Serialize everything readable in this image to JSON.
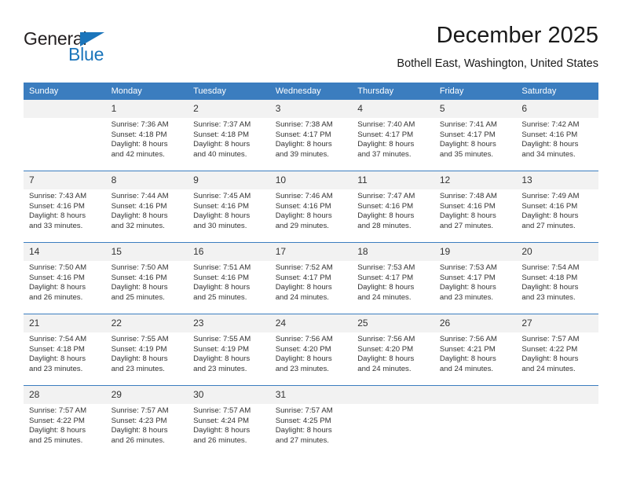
{
  "brand": {
    "name_part1": "General",
    "name_part2": "Blue",
    "triangle_icon": "triangle-icon"
  },
  "header": {
    "title": "December 2025",
    "subtitle": "Bothell East, Washington, United States"
  },
  "colors": {
    "header_blue": "#3b7dbf",
    "brand_blue": "#1b75bb",
    "daynum_bg": "#f2f2f2",
    "text": "#333333"
  },
  "weekday_headers": [
    "Sunday",
    "Monday",
    "Tuesday",
    "Wednesday",
    "Thursday",
    "Friday",
    "Saturday"
  ],
  "weeks": [
    [
      {
        "day": "",
        "sunrise": "",
        "sunset": "",
        "daylight1": "",
        "daylight2": ""
      },
      {
        "day": "1",
        "sunrise": "Sunrise: 7:36 AM",
        "sunset": "Sunset: 4:18 PM",
        "daylight1": "Daylight: 8 hours",
        "daylight2": "and 42 minutes."
      },
      {
        "day": "2",
        "sunrise": "Sunrise: 7:37 AM",
        "sunset": "Sunset: 4:18 PM",
        "daylight1": "Daylight: 8 hours",
        "daylight2": "and 40 minutes."
      },
      {
        "day": "3",
        "sunrise": "Sunrise: 7:38 AM",
        "sunset": "Sunset: 4:17 PM",
        "daylight1": "Daylight: 8 hours",
        "daylight2": "and 39 minutes."
      },
      {
        "day": "4",
        "sunrise": "Sunrise: 7:40 AM",
        "sunset": "Sunset: 4:17 PM",
        "daylight1": "Daylight: 8 hours",
        "daylight2": "and 37 minutes."
      },
      {
        "day": "5",
        "sunrise": "Sunrise: 7:41 AM",
        "sunset": "Sunset: 4:17 PM",
        "daylight1": "Daylight: 8 hours",
        "daylight2": "and 35 minutes."
      },
      {
        "day": "6",
        "sunrise": "Sunrise: 7:42 AM",
        "sunset": "Sunset: 4:16 PM",
        "daylight1": "Daylight: 8 hours",
        "daylight2": "and 34 minutes."
      }
    ],
    [
      {
        "day": "7",
        "sunrise": "Sunrise: 7:43 AM",
        "sunset": "Sunset: 4:16 PM",
        "daylight1": "Daylight: 8 hours",
        "daylight2": "and 33 minutes."
      },
      {
        "day": "8",
        "sunrise": "Sunrise: 7:44 AM",
        "sunset": "Sunset: 4:16 PM",
        "daylight1": "Daylight: 8 hours",
        "daylight2": "and 32 minutes."
      },
      {
        "day": "9",
        "sunrise": "Sunrise: 7:45 AM",
        "sunset": "Sunset: 4:16 PM",
        "daylight1": "Daylight: 8 hours",
        "daylight2": "and 30 minutes."
      },
      {
        "day": "10",
        "sunrise": "Sunrise: 7:46 AM",
        "sunset": "Sunset: 4:16 PM",
        "daylight1": "Daylight: 8 hours",
        "daylight2": "and 29 minutes."
      },
      {
        "day": "11",
        "sunrise": "Sunrise: 7:47 AM",
        "sunset": "Sunset: 4:16 PM",
        "daylight1": "Daylight: 8 hours",
        "daylight2": "and 28 minutes."
      },
      {
        "day": "12",
        "sunrise": "Sunrise: 7:48 AM",
        "sunset": "Sunset: 4:16 PM",
        "daylight1": "Daylight: 8 hours",
        "daylight2": "and 27 minutes."
      },
      {
        "day": "13",
        "sunrise": "Sunrise: 7:49 AM",
        "sunset": "Sunset: 4:16 PM",
        "daylight1": "Daylight: 8 hours",
        "daylight2": "and 27 minutes."
      }
    ],
    [
      {
        "day": "14",
        "sunrise": "Sunrise: 7:50 AM",
        "sunset": "Sunset: 4:16 PM",
        "daylight1": "Daylight: 8 hours",
        "daylight2": "and 26 minutes."
      },
      {
        "day": "15",
        "sunrise": "Sunrise: 7:50 AM",
        "sunset": "Sunset: 4:16 PM",
        "daylight1": "Daylight: 8 hours",
        "daylight2": "and 25 minutes."
      },
      {
        "day": "16",
        "sunrise": "Sunrise: 7:51 AM",
        "sunset": "Sunset: 4:16 PM",
        "daylight1": "Daylight: 8 hours",
        "daylight2": "and 25 minutes."
      },
      {
        "day": "17",
        "sunrise": "Sunrise: 7:52 AM",
        "sunset": "Sunset: 4:17 PM",
        "daylight1": "Daylight: 8 hours",
        "daylight2": "and 24 minutes."
      },
      {
        "day": "18",
        "sunrise": "Sunrise: 7:53 AM",
        "sunset": "Sunset: 4:17 PM",
        "daylight1": "Daylight: 8 hours",
        "daylight2": "and 24 minutes."
      },
      {
        "day": "19",
        "sunrise": "Sunrise: 7:53 AM",
        "sunset": "Sunset: 4:17 PM",
        "daylight1": "Daylight: 8 hours",
        "daylight2": "and 23 minutes."
      },
      {
        "day": "20",
        "sunrise": "Sunrise: 7:54 AM",
        "sunset": "Sunset: 4:18 PM",
        "daylight1": "Daylight: 8 hours",
        "daylight2": "and 23 minutes."
      }
    ],
    [
      {
        "day": "21",
        "sunrise": "Sunrise: 7:54 AM",
        "sunset": "Sunset: 4:18 PM",
        "daylight1": "Daylight: 8 hours",
        "daylight2": "and 23 minutes."
      },
      {
        "day": "22",
        "sunrise": "Sunrise: 7:55 AM",
        "sunset": "Sunset: 4:19 PM",
        "daylight1": "Daylight: 8 hours",
        "daylight2": "and 23 minutes."
      },
      {
        "day": "23",
        "sunrise": "Sunrise: 7:55 AM",
        "sunset": "Sunset: 4:19 PM",
        "daylight1": "Daylight: 8 hours",
        "daylight2": "and 23 minutes."
      },
      {
        "day": "24",
        "sunrise": "Sunrise: 7:56 AM",
        "sunset": "Sunset: 4:20 PM",
        "daylight1": "Daylight: 8 hours",
        "daylight2": "and 23 minutes."
      },
      {
        "day": "25",
        "sunrise": "Sunrise: 7:56 AM",
        "sunset": "Sunset: 4:20 PM",
        "daylight1": "Daylight: 8 hours",
        "daylight2": "and 24 minutes."
      },
      {
        "day": "26",
        "sunrise": "Sunrise: 7:56 AM",
        "sunset": "Sunset: 4:21 PM",
        "daylight1": "Daylight: 8 hours",
        "daylight2": "and 24 minutes."
      },
      {
        "day": "27",
        "sunrise": "Sunrise: 7:57 AM",
        "sunset": "Sunset: 4:22 PM",
        "daylight1": "Daylight: 8 hours",
        "daylight2": "and 24 minutes."
      }
    ],
    [
      {
        "day": "28",
        "sunrise": "Sunrise: 7:57 AM",
        "sunset": "Sunset: 4:22 PM",
        "daylight1": "Daylight: 8 hours",
        "daylight2": "and 25 minutes."
      },
      {
        "day": "29",
        "sunrise": "Sunrise: 7:57 AM",
        "sunset": "Sunset: 4:23 PM",
        "daylight1": "Daylight: 8 hours",
        "daylight2": "and 26 minutes."
      },
      {
        "day": "30",
        "sunrise": "Sunrise: 7:57 AM",
        "sunset": "Sunset: 4:24 PM",
        "daylight1": "Daylight: 8 hours",
        "daylight2": "and 26 minutes."
      },
      {
        "day": "31",
        "sunrise": "Sunrise: 7:57 AM",
        "sunset": "Sunset: 4:25 PM",
        "daylight1": "Daylight: 8 hours",
        "daylight2": "and 27 minutes."
      },
      {
        "day": "",
        "sunrise": "",
        "sunset": "",
        "daylight1": "",
        "daylight2": ""
      },
      {
        "day": "",
        "sunrise": "",
        "sunset": "",
        "daylight1": "",
        "daylight2": ""
      },
      {
        "day": "",
        "sunrise": "",
        "sunset": "",
        "daylight1": "",
        "daylight2": ""
      }
    ]
  ]
}
